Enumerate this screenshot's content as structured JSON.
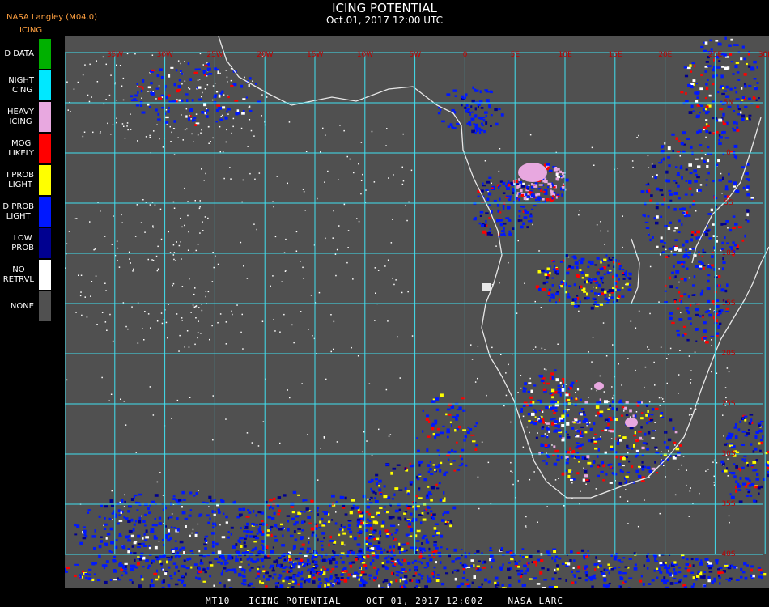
{
  "header": {
    "title": "ICING POTENTIAL",
    "subtitle": "Oct.01, 2017 12:00 UTC",
    "source": "NASA Langley (M04.0)",
    "legend_title": "ICING"
  },
  "legend": [
    {
      "label": "D DATA",
      "color": "#00b000"
    },
    {
      "label": "NIGHT\nICING",
      "color": "#00e8ff"
    },
    {
      "label": "HEAVY\nICING",
      "color": "#e8a8e0"
    },
    {
      "label": "MOG\nLIKELY",
      "color": "#ff0000"
    },
    {
      "label": "I PROB\nLIGHT",
      "color": "#ffff00"
    },
    {
      "label": "D PROB\nLIGHT",
      "color": "#0018ff"
    },
    {
      "label": "LOW\nPROB",
      "color": "#000090"
    },
    {
      "label": "NO\nRETRVL",
      "color": "#ffffff"
    },
    {
      "label": "NONE",
      "color": "#505050"
    }
  ],
  "map": {
    "background_color": "#505050",
    "grid_color": "#40e0f0",
    "coast_color": "#e8e8e8",
    "label_color": "#c00000",
    "lon_labels": [
      "35W",
      "30W",
      "25W",
      "20W",
      "15W",
      "10W",
      "5W",
      "0",
      "5E",
      "10E",
      "15E",
      "20E",
      "25E",
      "30E",
      "35E"
    ],
    "lat_labels": [
      "5N",
      "0",
      "5S",
      "10S",
      "15S",
      "20S",
      "25S",
      "30S",
      "35S",
      "40S",
      "45S"
    ]
  },
  "footer": "MT10   ICING POTENTIAL    OCT 01, 2017 12:00Z    NASA LARC"
}
